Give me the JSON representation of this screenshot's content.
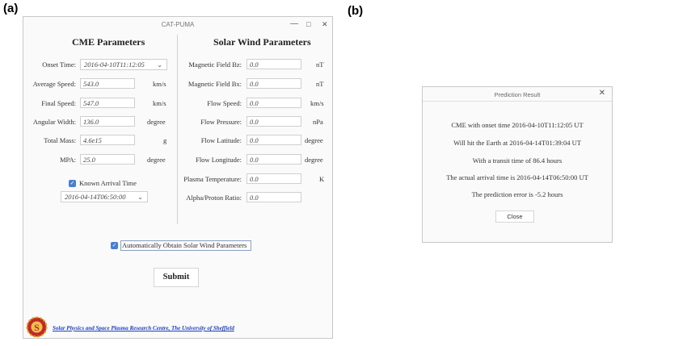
{
  "panels": {
    "a": "(a)",
    "b": "(b)"
  },
  "window": {
    "title": "CAT-PUMA",
    "controls": {
      "minimize": "—",
      "maximize": "□",
      "close": "✕"
    }
  },
  "cme": {
    "heading": "CME Parameters",
    "onset_label": "Onset Time:",
    "onset_value": "2016-04-10T11:12:05",
    "avg_speed_label": "Average Speed:",
    "avg_speed_value": "543.0",
    "avg_speed_unit": "km/s",
    "final_speed_label": "Final Speed:",
    "final_speed_value": "547.0",
    "final_speed_unit": "km/s",
    "angular_width_label": "Angular Width:",
    "angular_width_value": "136.0",
    "angular_width_unit": "degree",
    "total_mass_label": "Total Mass:",
    "total_mass_value": "4.6e15",
    "total_mass_unit": "g",
    "mpa_label": "MPA:",
    "mpa_value": "25.0",
    "mpa_unit": "degree",
    "known_arrival_label": "Known Arrival Time",
    "known_arrival_checked": true,
    "arrival_value": "2016-04-14T06:50:00"
  },
  "solar_wind": {
    "heading": "Solar Wind Parameters",
    "bz_label": "Magnetic Field Bz:",
    "bz_value": "0.0",
    "bz_unit": "nT",
    "bx_label": "Magnetic Field Bx:",
    "bx_value": "0.0",
    "bx_unit": "nT",
    "flow_speed_label": "Flow Speed:",
    "flow_speed_value": "0.0",
    "flow_speed_unit": "km/s",
    "flow_pressure_label": "Flow Pressure:",
    "flow_pressure_value": "0.0",
    "flow_pressure_unit": "nPa",
    "flow_lat_label": "Flow Latitude:",
    "flow_lat_value": "0.0",
    "flow_lat_unit": "degree",
    "flow_lon_label": "Flow Longitude:",
    "flow_lon_value": "0.0",
    "flow_lon_unit": "degree",
    "plasma_temp_label": "Plasma Temperature:",
    "plasma_temp_value": "0.0",
    "plasma_temp_unit": "K",
    "alpha_proton_label": "Alpha/Proton Ratio:",
    "alpha_proton_value": "0.0"
  },
  "auto_obtain": {
    "label": "Automatically Obtain Solar Wind Parameters",
    "checked": true
  },
  "submit_label": "Submit",
  "footer_link": "Solar Physics and Space Plasma Research Centre, The University of Sheffield",
  "logo_text": "S",
  "dialog": {
    "title": "Prediction Result",
    "close_icon": "✕",
    "line1": "CME with onset time 2016-04-10T11:12:05 UT",
    "line2": "Will hit the Earth at 2016-04-14T01:39:04 UT",
    "line3": "With a transit time of  86.4 hours",
    "line4": "The actual arrival time is 2016-04-14T06:50:00 UT",
    "line5": "The prediction error is  -5.2 hours",
    "close_label": "Close"
  },
  "colors": {
    "accent": "#4a7fd0",
    "link": "#1a3fbf",
    "logo_red": "#c0282b",
    "logo_gold": "#e0a020"
  }
}
